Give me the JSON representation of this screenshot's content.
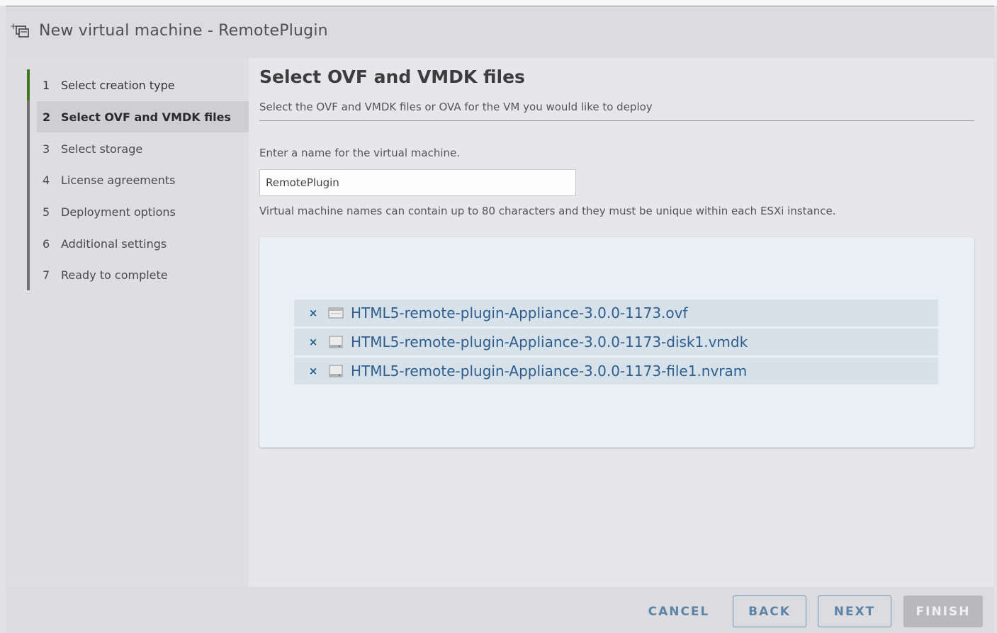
{
  "dialog": {
    "title": "New virtual machine - RemotePlugin",
    "title_icon": "new-vm-icon"
  },
  "steps": [
    {
      "num": "1",
      "label": "Select creation type",
      "state": "done"
    },
    {
      "num": "2",
      "label": "Select OVF and VMDK files",
      "state": "current"
    },
    {
      "num": "3",
      "label": "Select storage",
      "state": "pending"
    },
    {
      "num": "4",
      "label": "License agreements",
      "state": "pending"
    },
    {
      "num": "5",
      "label": "Deployment options",
      "state": "pending"
    },
    {
      "num": "6",
      "label": "Additional settings",
      "state": "pending"
    },
    {
      "num": "7",
      "label": "Ready to complete",
      "state": "pending"
    }
  ],
  "page": {
    "heading": "Select OVF and VMDK files",
    "subtitle": "Select the OVF and VMDK files or OVA for the VM you would like to deploy",
    "name_label": "Enter a name for the virtual machine.",
    "name_value": "RemotePlugin",
    "name_hint": "Virtual machine names can contain up to 80 characters and they must be unique within each ESXi instance."
  },
  "files": [
    {
      "name": "HTML5-remote-plugin-Appliance-3.0.0-1173.ovf",
      "icon": "ovf-file-icon"
    },
    {
      "name": "HTML5-remote-plugin-Appliance-3.0.0-1173-disk1.vmdk",
      "icon": "disk-file-icon"
    },
    {
      "name": "HTML5-remote-plugin-Appliance-3.0.0-1173-file1.nvram",
      "icon": "disk-file-icon"
    }
  ],
  "remove_glyph": "×",
  "footer": {
    "cancel": "CANCEL",
    "back": "BACK",
    "next": "NEXT",
    "finish": "FINISH"
  },
  "colors": {
    "active_step": "#3c7a1c",
    "link": "#2d5e8e",
    "button_text": "#5b84a7"
  }
}
